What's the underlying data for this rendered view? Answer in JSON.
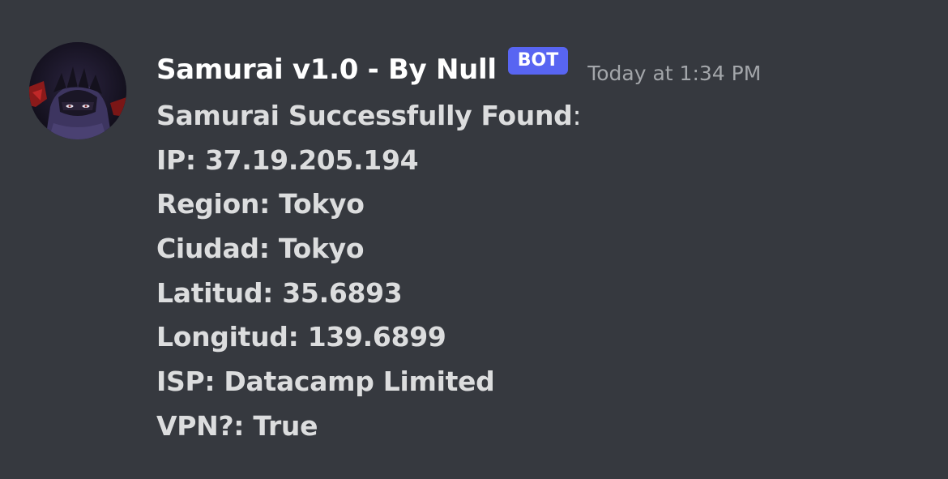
{
  "message": {
    "author": "Samurai v1.0 - By Null",
    "bot_tag": "BOT",
    "timestamp": "Today at 1:34 PM",
    "avatar_icon": "ninja-avatar-icon",
    "lines": {
      "title": "Samurai Successfully Found",
      "title_suffix": ":",
      "ip": "IP: 37.19.205.194",
      "region": "Region: Tokyo",
      "ciudad": "Ciudad: Tokyo",
      "latitud": "Latitud: 35.6893",
      "longitud": "Longitud: 139.6899",
      "isp": "ISP: Datacamp Limited",
      "vpn": "VPN?: True"
    }
  },
  "colors": {
    "background": "#36393f",
    "author": "#ffffff",
    "bot_tag_bg": "#5865f2",
    "timestamp": "#a3a6aa",
    "message_text": "#dcddde"
  }
}
